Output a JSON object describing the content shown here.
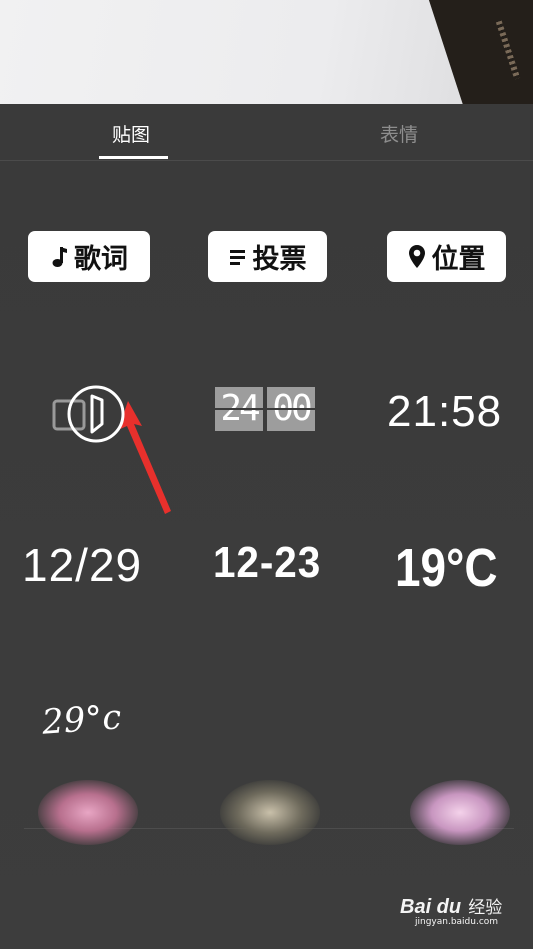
{
  "tabs": {
    "stickers": "贴图",
    "emoji": "表情",
    "active": "stickers"
  },
  "chips": {
    "lyrics": {
      "label": "歌词",
      "icon": "music-note-icon"
    },
    "vote": {
      "label": "投票",
      "icon": "list-icon"
    },
    "location": {
      "label": "位置",
      "icon": "location-pin-icon"
    }
  },
  "stickers": {
    "flip_clock": [
      "24",
      "00"
    ],
    "time_thin": "21:58",
    "date_slash": "12/29",
    "date_dash": "12-23",
    "temp_bold": "19°C",
    "temp_script": "29°c"
  },
  "decorative_stickers": [
    "hearts-sticker",
    "stars-sticker",
    "pink-heart-sticker"
  ],
  "watermark": {
    "logo": "Bai du",
    "text": "经验",
    "url": "jingyan.baidu.com"
  },
  "colors": {
    "panel": "#3a3a3a",
    "chip_bg": "#ffffff",
    "arrow": "#e8302c",
    "tab_inactive": "#8e8e8e"
  }
}
